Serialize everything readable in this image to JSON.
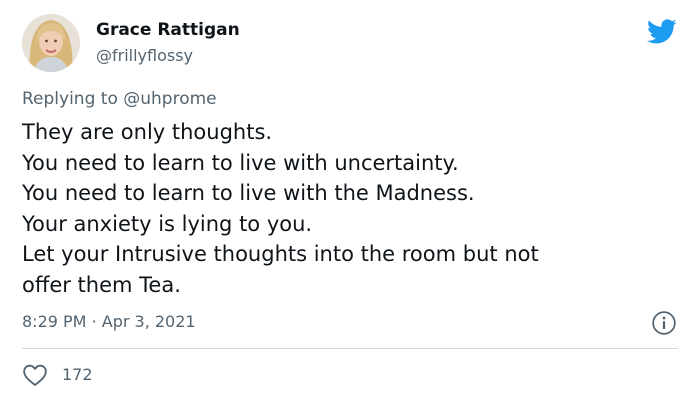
{
  "author": {
    "display_name": "Grace Rattigan",
    "handle": "@frillyflossy"
  },
  "reply": {
    "prefix": "Replying to",
    "mention": "@uhprome"
  },
  "tweet": {
    "lines": [
      "They are only thoughts.",
      "You need to learn to live with uncertainty.",
      "You need to learn to live with the Madness.",
      "Your anxiety is lying to you.",
      "Let your Intrusive thoughts into the room but not",
      "offer them Tea."
    ]
  },
  "meta": {
    "time": "8:29 PM",
    "separator": "·",
    "date": "Apr 3, 2021"
  },
  "engagement": {
    "likes": "172"
  },
  "icons": {
    "brand": "twitter-bird-icon",
    "info": "info-icon",
    "like": "heart-icon"
  },
  "colors": {
    "brand_blue": "#1d9bf0",
    "text_primary": "#0f1419",
    "text_secondary": "#536471",
    "divider": "#cfd9de"
  }
}
